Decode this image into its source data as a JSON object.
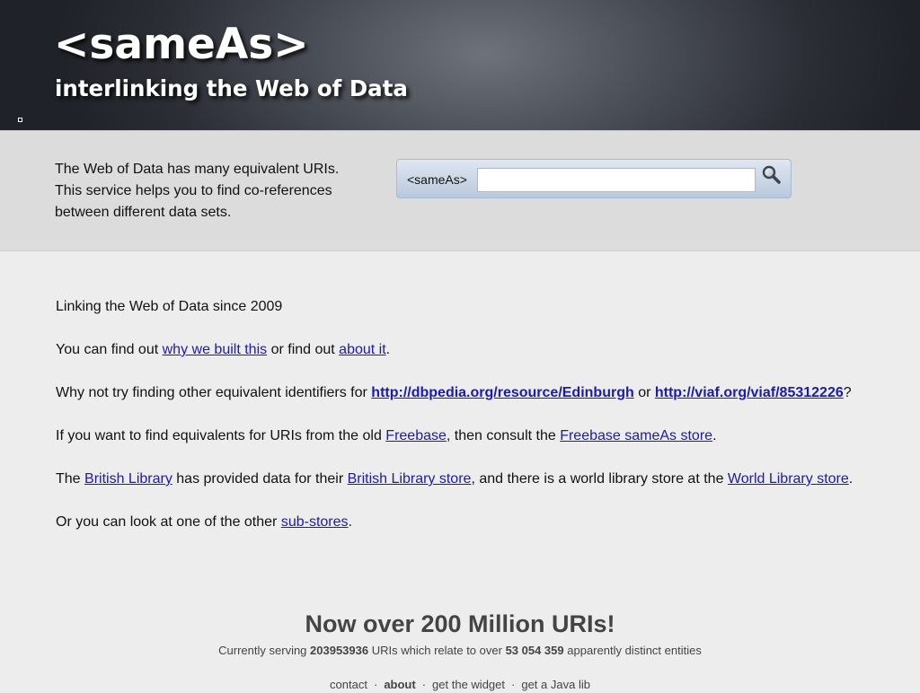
{
  "header": {
    "title": "<sameAs>",
    "subtitle": "interlinking the Web of Data"
  },
  "intro": {
    "lines": [
      "The Web of Data has many equivalent URIs.",
      "This service helps you to find co-references",
      "between different data sets."
    ]
  },
  "search": {
    "label": "<sameAs>",
    "value": "",
    "placeholder": "",
    "button_icon": "magnifier-icon",
    "button_title": "Search"
  },
  "content": {
    "since": "Linking the Web of Data since 2009",
    "find_out": {
      "pre": "You can find out ",
      "link1": "why we built this",
      "mid": " or find out ",
      "link2": "about it",
      "post": "."
    },
    "why_not": {
      "pre": "Why not try finding other equivalent identifiers for ",
      "link1": "http://dbpedia.org/resource/Edinburgh",
      "mid": " or ",
      "link2": "http://viaf.org/viaf/85312226",
      "post": "?"
    },
    "freebase": {
      "pre": "If you want to find equivalents for URIs from the old ",
      "link1": "Freebase",
      "mid": ", then consult the ",
      "link2": "Freebase sameAs store",
      "post": "."
    },
    "british_library": {
      "pre": "The ",
      "link1": "British Library",
      "mid1": " has provided data for their ",
      "link2": "British Library store",
      "mid2": ", and there is a world library store at the ",
      "link3": "World Library store",
      "post": "."
    },
    "substores": {
      "pre": "Or you can look at one of the other ",
      "link1": "sub-stores",
      "post": "."
    }
  },
  "footer": {
    "headline": "Now over 200 Million URIs!",
    "stats": {
      "pre": "Currently serving ",
      "uri_count": "203953936",
      "mid": " URIs which relate to over ",
      "entity_count": "53 054 359",
      "post": " apparently distinct entities"
    },
    "nav": [
      {
        "label": "contact",
        "active": false
      },
      {
        "label": "about",
        "active": true
      },
      {
        "label": "get the widget",
        "active": false
      },
      {
        "label": "get a Java lib",
        "active": false
      }
    ],
    "separator": "·"
  },
  "colors": {
    "link": "#1a1ab5",
    "header_bg": "#2b2e35",
    "intro_bg": "#dcdcdc",
    "page_bg": "#ededed",
    "search_box": "#c9d6e6"
  }
}
